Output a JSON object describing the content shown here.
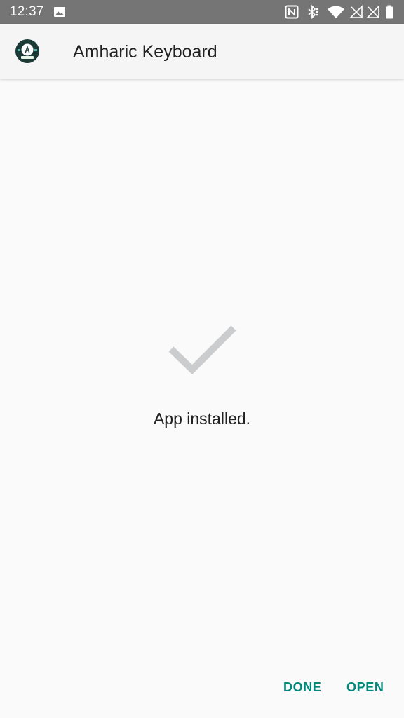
{
  "status_bar": {
    "time": "12:37",
    "icons": [
      "image-icon",
      "nfc-icon",
      "bluetooth-icon",
      "wifi-icon",
      "signal-1-icon",
      "signal-2-icon",
      "battery-icon"
    ],
    "background": "#757575"
  },
  "app_bar": {
    "title": "Amharic Keyboard",
    "icon": "amharic-keyboard-app-icon"
  },
  "content": {
    "icon": "checkmark-icon",
    "message": "App installed."
  },
  "actions": {
    "done_label": "DONE",
    "open_label": "OPEN",
    "accent_color": "#00897b"
  }
}
